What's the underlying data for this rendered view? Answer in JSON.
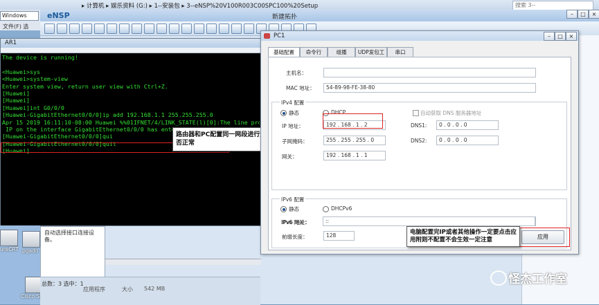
{
  "explorer": {
    "path": "▸ 计算机 ▸ 娱乐资料 (G:) ▸ 1--安装包 ▸ 3--eNSP%20V100R003C00SPC100%20Setup",
    "search_placeholder": "搜索 3--eNSP%20V100R00..."
  },
  "windows_strip": {
    "tab": "Windows",
    "menu": "文件(F)  选"
  },
  "ensp": {
    "logo": "eNSP",
    "center_title": "新建拓扑"
  },
  "ar1": {
    "title": "AR1",
    "terminal_lines": [
      "The device is running!",
      "",
      "<Huawei>sys",
      "<Huawei>system-view",
      "Enter system view, return user view with Ctrl+Z.",
      "[Huawei]",
      "[Huawei]",
      "[Huawei]int G0/0/0",
      "[Huawei-GigabitEthernet0/0/0]ip add 192.168.1.1 255.255.255.0",
      "Apr 15 2019 16:11:10-08:00 Huawei %%01IFNET/4/LINK_STATE(l)[0]:The line proto",
      " IP on the interface GigabitEthernet0/0/0 has entered the UP state.",
      "[Huawei-GigabitEthernet0/0/0]qui",
      "[Huawei-GigabitEthernet0/0/0]quit",
      "[Huawei]"
    ]
  },
  "annotation_router": "路由器和PC配置同一网段进行测，进而检查模拟器是否正常",
  "hint_panel": "自动选择接口连接设备。",
  "status": {
    "count": "总数：3  选中：1",
    "app": "应用程序",
    "size_label": "大小",
    "size_value": "542 MB"
  },
  "desktop_icons": [
    {
      "label": "ureCRT"
    },
    {
      "label": "pgadn"
    },
    {
      "label": "Cisco Stac"
    }
  ],
  "pc1": {
    "title": "PC1",
    "tabs": [
      "基础配置",
      "命令行",
      "组播",
      "UDP发包工具",
      "串口"
    ],
    "hostname_label": "主机名：",
    "hostname_value": "",
    "mac_label": "MAC 地址：",
    "mac_value": "54-89-98-FE-38-80",
    "ipv4_group": "IPv4 配置",
    "static_label": "静态",
    "dhcp_label": "DHCP",
    "auto_dns_label": "自动获取 DNS 服务器地址",
    "ip_label": "IP 地址：",
    "ip_value": "192 . 168 . 1 . 2",
    "mask_label": "子网掩码：",
    "mask_value": "255 . 255 . 255 . 0",
    "gateway_label": "网关：",
    "gateway_value": "192 . 168 . 1 . 1",
    "dns1_label": "DNS1:",
    "dns1_value": "0 . 0 . 0 . 0",
    "dns2_label": "DNS2:",
    "dns2_value": "0 . 0 . 0 . 0",
    "ipv6_group": "IPv6 配置",
    "static6_label": "静态",
    "dhcpv6_label": "DHCPv6",
    "ipv6_label": "IPv6 地址：",
    "ipv6_value": "::",
    "prefix_label": "前缀长度：",
    "prefix_value": "128",
    "gateway6_label": "IPv6 网关：",
    "gateway6_value": "::",
    "apply_label": "应用"
  },
  "annotation_pc": "电脑配置完IP或者其他操作一定要点击应用附则不配置不会生效一定注意",
  "watermark": "怪杰工作室"
}
